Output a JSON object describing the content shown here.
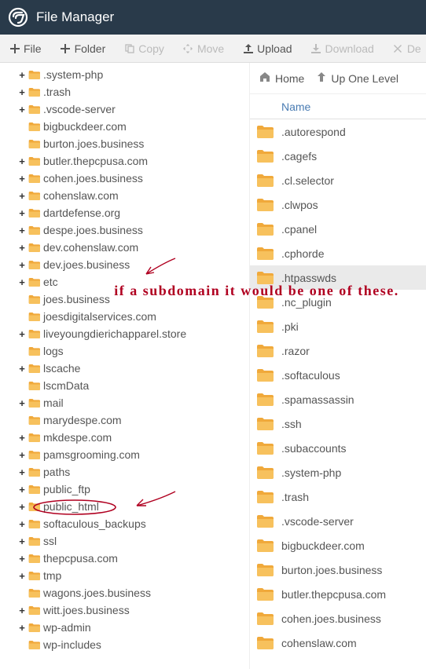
{
  "header": {
    "title": "File Manager"
  },
  "toolbar": {
    "file": "File",
    "folder": "Folder",
    "copy": "Copy",
    "move": "Move",
    "upload": "Upload",
    "download": "Download",
    "delete": "De"
  },
  "crumbs": {
    "home": "Home",
    "up": "Up One Level"
  },
  "columns": {
    "name": "Name"
  },
  "tree": [
    {
      "label": ".system-php",
      "exp": true
    },
    {
      "label": ".trash",
      "exp": true
    },
    {
      "label": ".vscode-server",
      "exp": true
    },
    {
      "label": "bigbuckdeer.com",
      "exp": false
    },
    {
      "label": "burton.joes.business",
      "exp": false
    },
    {
      "label": "butler.thepcpusa.com",
      "exp": true
    },
    {
      "label": "cohen.joes.business",
      "exp": true
    },
    {
      "label": "cohenslaw.com",
      "exp": true
    },
    {
      "label": "dartdefense.org",
      "exp": true
    },
    {
      "label": "despe.joes.business",
      "exp": true
    },
    {
      "label": "dev.cohenslaw.com",
      "exp": true
    },
    {
      "label": "dev.joes.business",
      "exp": true
    },
    {
      "label": "etc",
      "exp": true
    },
    {
      "label": "joes.business",
      "exp": false
    },
    {
      "label": "joesdigitalservices.com",
      "exp": false
    },
    {
      "label": "liveyoungdierichapparel.store",
      "exp": true
    },
    {
      "label": "logs",
      "exp": false
    },
    {
      "label": "lscache",
      "exp": true
    },
    {
      "label": "lscmData",
      "exp": false
    },
    {
      "label": "mail",
      "exp": true
    },
    {
      "label": "marydespe.com",
      "exp": false
    },
    {
      "label": "mkdespe.com",
      "exp": true
    },
    {
      "label": "pamsgrooming.com",
      "exp": true
    },
    {
      "label": "paths",
      "exp": true
    },
    {
      "label": "public_ftp",
      "exp": true
    },
    {
      "label": "public_html",
      "exp": true
    },
    {
      "label": "softaculous_backups",
      "exp": true
    },
    {
      "label": "ssl",
      "exp": true
    },
    {
      "label": "thepcpusa.com",
      "exp": true
    },
    {
      "label": "tmp",
      "exp": true
    },
    {
      "label": "wagons.joes.business",
      "exp": false
    },
    {
      "label": "witt.joes.business",
      "exp": true
    },
    {
      "label": "wp-admin",
      "exp": true
    },
    {
      "label": "wp-includes",
      "exp": false
    }
  ],
  "files": [
    {
      "name": ".autorespond"
    },
    {
      "name": ".cagefs"
    },
    {
      "name": ".cl.selector"
    },
    {
      "name": ".clwpos"
    },
    {
      "name": ".cpanel"
    },
    {
      "name": ".cphorde"
    },
    {
      "name": ".htpasswds",
      "selected": true
    },
    {
      "name": ".nc_plugin"
    },
    {
      "name": ".pki"
    },
    {
      "name": ".razor"
    },
    {
      "name": ".softaculous"
    },
    {
      "name": ".spamassassin"
    },
    {
      "name": ".ssh"
    },
    {
      "name": ".subaccounts"
    },
    {
      "name": ".system-php"
    },
    {
      "name": ".trash"
    },
    {
      "name": ".vscode-server"
    },
    {
      "name": "bigbuckdeer.com"
    },
    {
      "name": "burton.joes.business"
    },
    {
      "name": "butler.thepcpusa.com"
    },
    {
      "name": "cohen.joes.business"
    },
    {
      "name": "cohenslaw.com"
    }
  ],
  "annotation": {
    "text": "if a subdomain it would be one of these."
  }
}
